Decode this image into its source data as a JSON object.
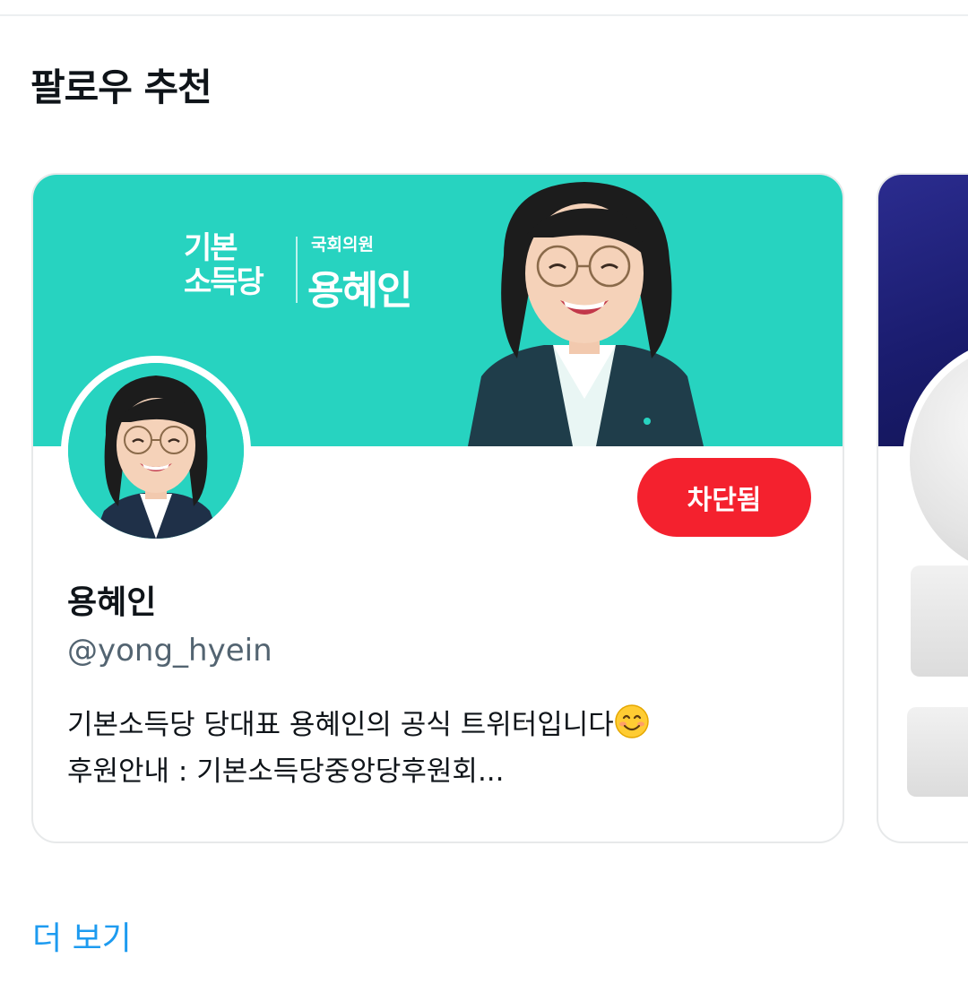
{
  "section": {
    "title": "팔로우 추천"
  },
  "card": {
    "banner": {
      "party_line1": "기본",
      "party_line2": "소득당",
      "role": "국회의원",
      "name": "용혜인"
    },
    "blocked_label": "차단됨",
    "display_name": "용혜인",
    "handle": "@yong_hyein",
    "bio_line1": "기본소득당 당대표 용혜인의 공식 트위터입니다",
    "bio_line2": "후원안내 : 기본소득당중앙당후원회...",
    "bio_emoji": "smiling-face-emoji"
  },
  "colors": {
    "banner": "#27d3c0",
    "blocked_button": "#f4212e",
    "link": "#1d9bf0",
    "handle": "#536471"
  },
  "footer": {
    "show_more": "더 보기"
  }
}
